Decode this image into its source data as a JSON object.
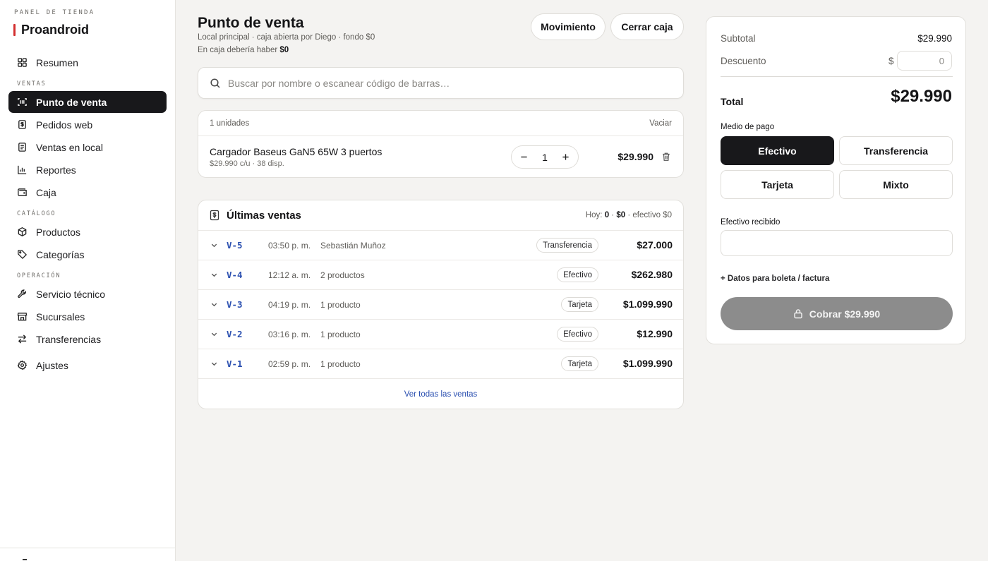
{
  "sidebar": {
    "kicker": "PANEL DE TIENDA",
    "brand": "Proandroid",
    "accent_color": "#d32f2f",
    "sections": {
      "ventas": "VENTAS",
      "catalogo": "CATÁLOGO",
      "operacion": "OPERACIÓN"
    },
    "items": [
      {
        "label": "Resumen",
        "icon": "grid-icon"
      },
      {
        "label": "Punto de venta",
        "icon": "barcode-scan-icon",
        "active": true
      },
      {
        "label": "Pedidos web",
        "icon": "receipt-icon"
      },
      {
        "label": "Ventas en local",
        "icon": "document-icon"
      },
      {
        "label": "Reportes",
        "icon": "bar-chart-icon"
      },
      {
        "label": "Caja",
        "icon": "wallet-icon"
      },
      {
        "label": "Productos",
        "icon": "box-icon"
      },
      {
        "label": "Categorías",
        "icon": "tag-icon"
      },
      {
        "label": "Servicio técnico",
        "icon": "wrench-icon"
      },
      {
        "label": "Sucursales",
        "icon": "store-icon"
      },
      {
        "label": "Transferencias",
        "icon": "arrows-swap-icon"
      },
      {
        "label": "Ajustes",
        "icon": "gear-icon"
      }
    ]
  },
  "header": {
    "title": "Punto de venta",
    "subtitle": "Local principal · caja abierta por Diego · fondo $0",
    "cash_expected_prefix": "En caja debería haber",
    "cash_expected_value": "$0",
    "movement_button": "Movimiento",
    "close_register_button": "Cerrar caja"
  },
  "search": {
    "placeholder": "Buscar por nombre o escanear código de barras…"
  },
  "cart": {
    "units_label": "1 unidades",
    "clear_label": "Vaciar",
    "items": [
      {
        "name": "Cargador Baseus GaN5 65W 3 puertos",
        "meta": "$29.990 c/u · 38 disp.",
        "qty": "1",
        "price": "$29.990"
      }
    ]
  },
  "recent_sales": {
    "title": "Últimas ventas",
    "stats_prefix": "Hoy:",
    "stats_count": "0",
    "stats_amount": "$0",
    "stats_suffix": "efectivo $0",
    "view_all": "Ver todas las ventas",
    "rows": [
      {
        "id": "V-5",
        "time": "03:50 p. m.",
        "desc": "Sebastián Muñoz",
        "method": "Transferencia",
        "amount": "$27.000"
      },
      {
        "id": "V-4",
        "time": "12:12 a. m.",
        "desc": "2 productos",
        "method": "Efectivo",
        "amount": "$262.980"
      },
      {
        "id": "V-3",
        "time": "04:19 p. m.",
        "desc": "1 producto",
        "method": "Tarjeta",
        "amount": "$1.099.990"
      },
      {
        "id": "V-2",
        "time": "03:16 p. m.",
        "desc": "1 producto",
        "method": "Efectivo",
        "amount": "$12.990"
      },
      {
        "id": "V-1",
        "time": "02:59 p. m.",
        "desc": "1 producto",
        "method": "Tarjeta",
        "amount": "$1.099.990"
      }
    ]
  },
  "summary": {
    "subtotal_label": "Subtotal",
    "subtotal_value": "$29.990",
    "discount_label": "Descuento",
    "discount_currency": "$",
    "discount_placeholder": "0",
    "total_label": "Total",
    "total_value": "$29.990",
    "payment_label": "Medio de pago",
    "payment_methods": [
      "Efectivo",
      "Transferencia",
      "Tarjeta",
      "Mixto"
    ],
    "selected_payment": "Efectivo",
    "cash_received_label": "Efectivo recibido",
    "billing_link": "+ Datos para boleta / factura",
    "charge_button": "Cobrar $29.990"
  }
}
